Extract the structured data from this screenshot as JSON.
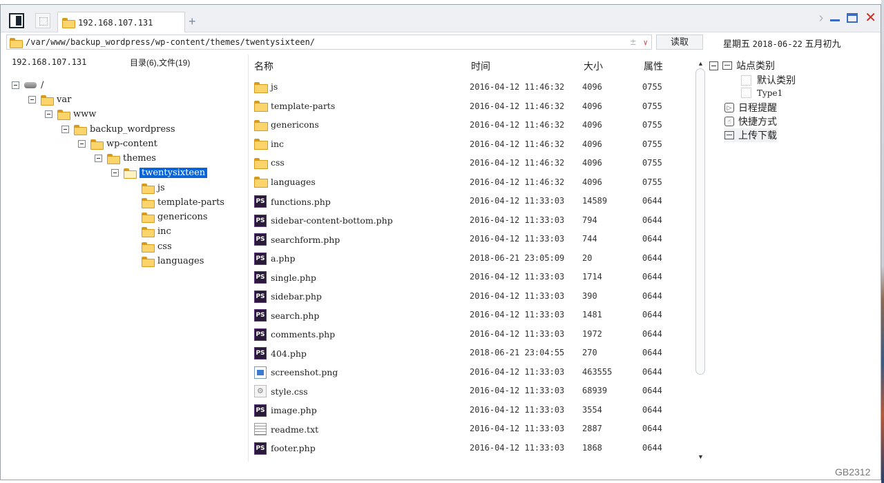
{
  "titlebar": {
    "tab_label": "192.168.107.131",
    "new_tab": "+"
  },
  "address": {
    "path": "/var/www/backup_wordpress/wp-content/themes/twentysixteen/",
    "pm": "±",
    "dropdown": "∨",
    "read_button": "读取"
  },
  "date": {
    "weekday": "星期五",
    "date": "2018-06-22",
    "lunar": "五月初九"
  },
  "left": {
    "host": "192.168.107.131",
    "count": "目录(6),文件(19)",
    "tree": [
      {
        "label": "/",
        "level": 0,
        "kind": "root"
      },
      {
        "label": "var",
        "level": 1,
        "kind": "folder"
      },
      {
        "label": "www",
        "level": 2,
        "kind": "folder"
      },
      {
        "label": "backup_wordpress",
        "level": 3,
        "kind": "folder"
      },
      {
        "label": "wp-content",
        "level": 4,
        "kind": "folder"
      },
      {
        "label": "themes",
        "level": 5,
        "kind": "folder"
      },
      {
        "label": "twentysixteen",
        "level": 6,
        "kind": "folder",
        "selected": true
      },
      {
        "label": "js",
        "level": 7,
        "kind": "leaf"
      },
      {
        "label": "template-parts",
        "level": 7,
        "kind": "leaf"
      },
      {
        "label": "genericons",
        "level": 7,
        "kind": "leaf"
      },
      {
        "label": "inc",
        "level": 7,
        "kind": "leaf"
      },
      {
        "label": "css",
        "level": 7,
        "kind": "leaf"
      },
      {
        "label": "languages",
        "level": 7,
        "kind": "leaf"
      }
    ]
  },
  "list": {
    "headers": {
      "name": "名称",
      "time": "时间",
      "size": "大小",
      "attr": "属性"
    },
    "rows": [
      {
        "icon": "folder",
        "name": "js",
        "time": "2016-04-12 11:46:32",
        "size": "4096",
        "attr": "0755"
      },
      {
        "icon": "folder",
        "name": "template-parts",
        "time": "2016-04-12 11:46:32",
        "size": "4096",
        "attr": "0755"
      },
      {
        "icon": "folder",
        "name": "genericons",
        "time": "2016-04-12 11:46:32",
        "size": "4096",
        "attr": "0755"
      },
      {
        "icon": "folder",
        "name": "inc",
        "time": "2016-04-12 11:46:32",
        "size": "4096",
        "attr": "0755"
      },
      {
        "icon": "folder",
        "name": "css",
        "time": "2016-04-12 11:46:32",
        "size": "4096",
        "attr": "0755"
      },
      {
        "icon": "folder",
        "name": "languages",
        "time": "2016-04-12 11:46:32",
        "size": "4096",
        "attr": "0755"
      },
      {
        "icon": "php",
        "name": "functions.php",
        "time": "2016-04-12 11:33:03",
        "size": "14589",
        "attr": "0644"
      },
      {
        "icon": "php",
        "name": "sidebar-content-bottom.php",
        "time": "2016-04-12 11:33:03",
        "size": "794",
        "attr": "0644"
      },
      {
        "icon": "php",
        "name": "searchform.php",
        "time": "2016-04-12 11:33:03",
        "size": "744",
        "attr": "0644"
      },
      {
        "icon": "php",
        "name": "a.php",
        "time": "2018-06-21 23:05:09",
        "size": "20",
        "attr": "0644"
      },
      {
        "icon": "php",
        "name": "single.php",
        "time": "2016-04-12 11:33:03",
        "size": "1714",
        "attr": "0644"
      },
      {
        "icon": "php",
        "name": "sidebar.php",
        "time": "2016-04-12 11:33:03",
        "size": "390",
        "attr": "0644"
      },
      {
        "icon": "php",
        "name": "search.php",
        "time": "2016-04-12 11:33:03",
        "size": "1481",
        "attr": "0644"
      },
      {
        "icon": "php",
        "name": "comments.php",
        "time": "2016-04-12 11:33:03",
        "size": "1972",
        "attr": "0644"
      },
      {
        "icon": "php",
        "name": "404.php",
        "time": "2018-06-21 23:04:55",
        "size": "270",
        "attr": "0644"
      },
      {
        "icon": "png",
        "name": "screenshot.png",
        "time": "2016-04-12 11:33:03",
        "size": "463555",
        "attr": "0644"
      },
      {
        "icon": "css",
        "name": "style.css",
        "time": "2016-04-12 11:33:03",
        "size": "68939",
        "attr": "0644"
      },
      {
        "icon": "php",
        "name": "image.php",
        "time": "2016-04-12 11:33:03",
        "size": "3554",
        "attr": "0644"
      },
      {
        "icon": "txt",
        "name": "readme.txt",
        "time": "2016-04-12 11:33:03",
        "size": "2887",
        "attr": "0644"
      },
      {
        "icon": "php",
        "name": "footer.php",
        "time": "2016-04-12 11:33:03",
        "size": "1868",
        "attr": "0644"
      }
    ]
  },
  "right": {
    "site_category": "站点类别",
    "default_category": "默认类别",
    "type1": "Type1",
    "schedule": "日程提醒",
    "shortcuts": "快捷方式",
    "upload_download": "上传下载"
  },
  "status": {
    "encoding": "GB2312"
  }
}
